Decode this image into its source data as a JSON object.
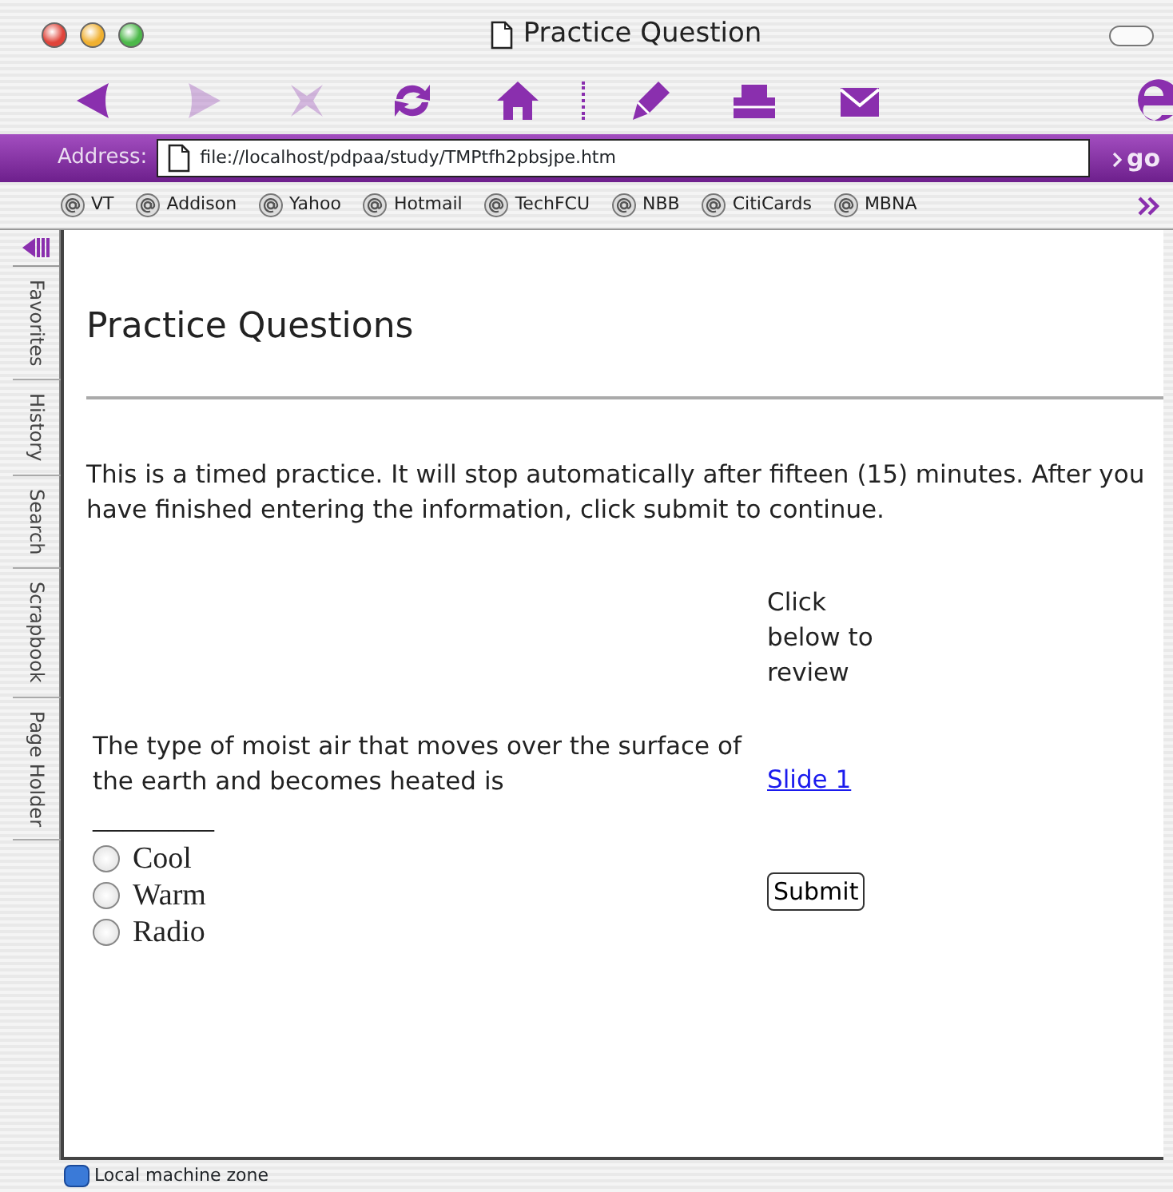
{
  "window": {
    "title": "Practice Question"
  },
  "toolbar": [
    {
      "kind": "back",
      "disabled": false
    },
    {
      "kind": "forward",
      "disabled": true
    },
    {
      "kind": "stop",
      "disabled": true
    },
    {
      "kind": "refresh",
      "disabled": false
    },
    {
      "kind": "home",
      "disabled": false
    },
    {
      "kind": "separator"
    },
    {
      "kind": "edit",
      "disabled": false
    },
    {
      "kind": "print",
      "disabled": false
    },
    {
      "kind": "mail",
      "disabled": false
    }
  ],
  "address_bar": {
    "label": "Address:",
    "value": "file://localhost/pdpaa/study/TMPtfh2pbsjpe.htm",
    "go": "go"
  },
  "favorites": [
    "VT",
    "Addison",
    "Yahoo",
    "Hotmail",
    "TechFCU",
    "NBB",
    "CitiCards",
    "MBNA"
  ],
  "sidebar_tabs": [
    "Favorites",
    "History",
    "Search",
    "Scrapbook",
    "Page Holder"
  ],
  "page": {
    "heading": "Practice Questions",
    "intro": "This is a timed practice. It will stop automatically after fifteen (15) minutes. After you have finished entering the information, click submit to continue.",
    "review_note": "Click below to review",
    "review_link": "Slide 1",
    "question": "The type of moist air that moves over the surface of the earth and becomes heated is",
    "blank": "________",
    "options": [
      {
        "label": "Cool",
        "selected": false
      },
      {
        "label": "Warm",
        "selected": false
      },
      {
        "label": "Radio",
        "selected": false
      }
    ],
    "submit": "Submit"
  },
  "status_bar": {
    "zone": "Local machine zone"
  }
}
